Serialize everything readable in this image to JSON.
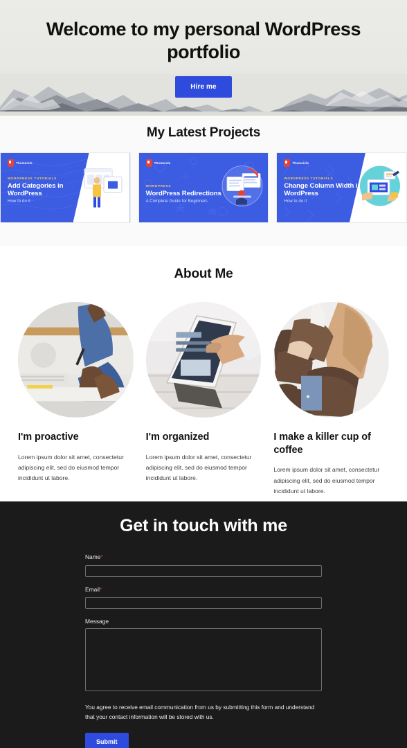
{
  "hero": {
    "title": "Welcome to my personal WordPress portfolio",
    "cta_label": "Hire me",
    "background": "snow-mountain-photo",
    "accent_color": "#2f4bdd"
  },
  "projects": {
    "heading": "My Latest Projects",
    "background_color": "#fafafa",
    "cards": [
      {
        "brand": "Themeisle",
        "eyebrow": "WORDPRESS TUTORIALS",
        "title": "Add Categories in WordPress",
        "subtitle": "How to do it",
        "card_color": "#3c5ce2"
      },
      {
        "brand": "Themeisle",
        "eyebrow": "WORDPRESS",
        "title": "WordPress Redirections",
        "subtitle": "A Complete Guide for Beginners",
        "card_color": "#3c5ce2"
      },
      {
        "brand": "Themeisle",
        "eyebrow": "WORDPRESS TUTORIALS",
        "title": "Change Column Width in WordPress",
        "subtitle": "How to do it",
        "card_color": "#3c5ce2"
      }
    ]
  },
  "about": {
    "heading": "About Me",
    "items": [
      {
        "photo": "man-writing-at-desk-photo",
        "title": "I'm proactive",
        "body": "Lorem ipsum dolor sit amet, consectetur adipiscing elit, sed do eiusmod tempor incididunt ut labore."
      },
      {
        "photo": "hand-touching-tablet-photo",
        "title": "I'm organized",
        "body": "Lorem ipsum dolor sit amet, consectetur adipiscing elit, sed do eiusmod tempor incididunt ut labore."
      },
      {
        "photo": "person-holding-coffee-photo",
        "title": "I make a killer cup of coffee",
        "body": "Lorem ipsum dolor sit amet, consectetur adipiscing elit, sed do eiusmod tempor incididunt ut labore."
      }
    ]
  },
  "contact": {
    "heading": "Get in touch with me",
    "background_color": "#1b1b1b",
    "required_marker": "*",
    "fields": {
      "name_label": "Name",
      "name_value": "",
      "name_placeholder": "",
      "email_label": "Email",
      "email_value": "",
      "email_placeholder": "",
      "message_label": "Message",
      "message_value": "",
      "message_placeholder": ""
    },
    "consent_text": "You agree to receive email communication from us by submitting this form and understand that your contact information will be stored with us.",
    "submit_label": "Submit",
    "submit_color": "#2f4bdd"
  }
}
